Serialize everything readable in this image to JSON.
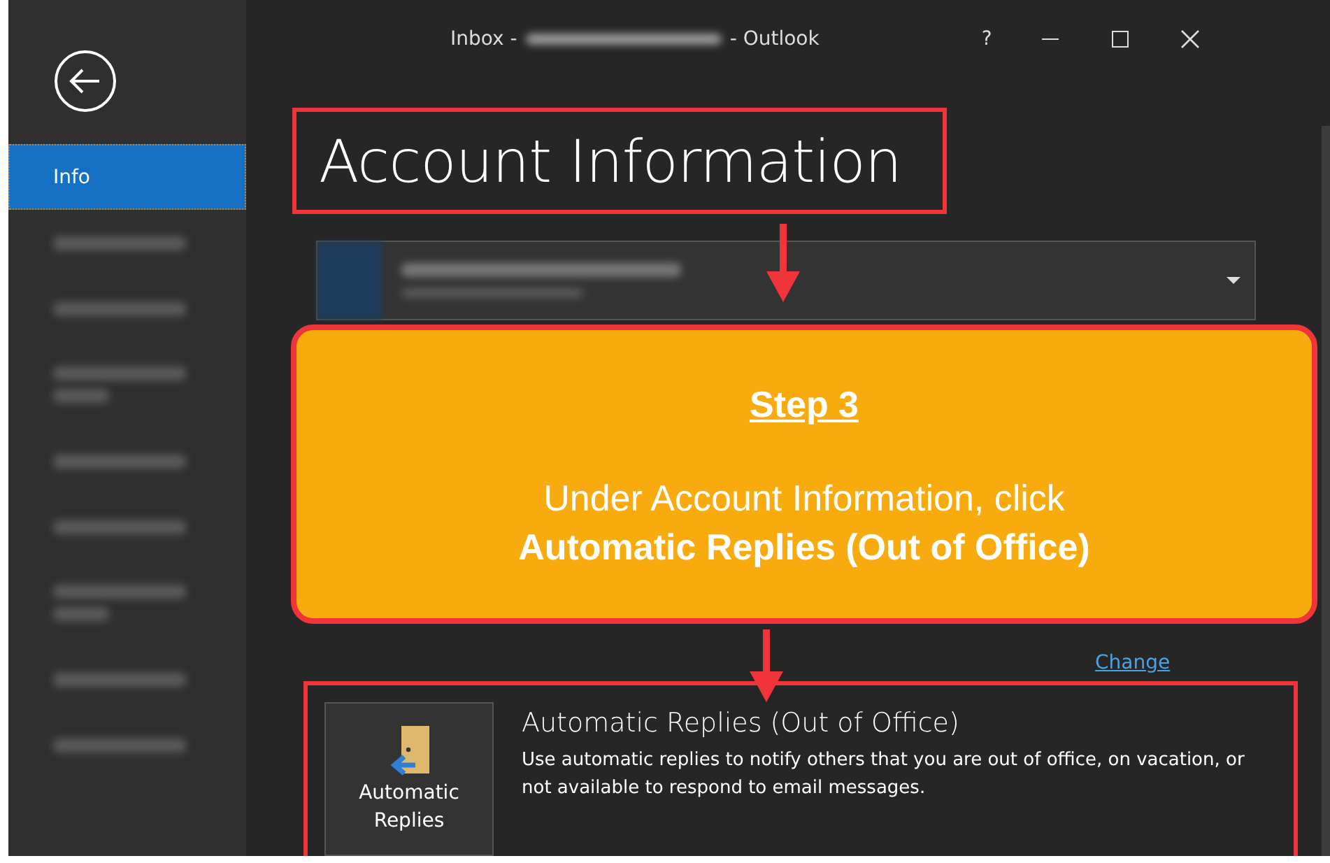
{
  "window": {
    "title_before": "Inbox -",
    "title_after": "- Outlook",
    "help": "?"
  },
  "sidebar": {
    "items": [
      {
        "kind": "label",
        "label": "Info",
        "selected": true
      },
      {
        "kind": "redacted",
        "selected": false
      },
      {
        "kind": "redacted",
        "selected": false
      },
      {
        "kind": "redacted-tall",
        "selected": false
      },
      {
        "kind": "redacted",
        "selected": false
      },
      {
        "kind": "redacted",
        "selected": false
      },
      {
        "kind": "redacted-tall",
        "selected": false
      },
      {
        "kind": "redacted",
        "selected": false
      },
      {
        "kind": "redacted",
        "selected": false
      }
    ]
  },
  "heading": "Account Information",
  "callout": {
    "step": "Step 3",
    "line": "Under Account Information, click",
    "emphasis": "Automatic Replies (Out of Office)"
  },
  "change_link": "Change",
  "auto_replies": {
    "button": [
      "Automatic",
      "Replies"
    ],
    "title": "Automatic Replies (Out of Office)",
    "description": "Use automatic replies to notify others that you are out of office, on vacation, or not available to respond to email messages."
  }
}
